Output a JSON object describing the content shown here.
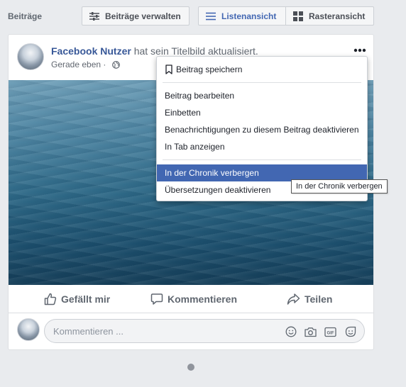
{
  "header": {
    "section_title": "Beiträge",
    "manage_label": "Beiträge verwalten",
    "list_view_label": "Listenansicht",
    "grid_view_label": "Rasteransicht"
  },
  "post": {
    "author": "Facebook Nutzer",
    "action_text": " hat sein Titelbild aktualisiert.",
    "timestamp": "Gerade eben",
    "separator": " · ",
    "privacy_icon": "globe-icon"
  },
  "menu": {
    "items": [
      {
        "label": "Beitrag speichern",
        "icon": "bookmark-icon"
      },
      {
        "label": "Beitrag bearbeiten"
      },
      {
        "label": "Einbetten"
      },
      {
        "label": "Benachrichtigungen zu diesem Beitrag deaktivieren"
      },
      {
        "label": "In Tab anzeigen"
      },
      {
        "label": "In der Chronik verbergen",
        "state": "highlighted"
      },
      {
        "label": "Übersetzungen deaktivieren"
      }
    ]
  },
  "tooltip": {
    "text": "In der Chronik verbergen"
  },
  "actions": {
    "like": "Gefällt mir",
    "comment": "Kommentieren",
    "share": "Teilen"
  },
  "comment_input": {
    "placeholder": "Kommentieren ...",
    "icons": [
      "emoji-icon",
      "camera-icon",
      "gif-icon",
      "sticker-icon"
    ]
  },
  "colors": {
    "accent": "#4267b2",
    "link": "#385898",
    "background": "#e9ebee"
  }
}
